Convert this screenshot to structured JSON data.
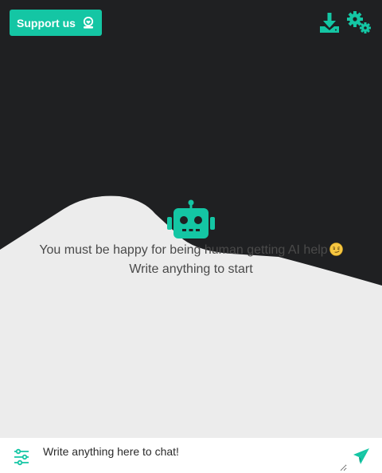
{
  "colors": {
    "accent": "#14c6a4",
    "dark_background": "#1f2022",
    "light_background": "#ececec",
    "text": "#4a4a4a"
  },
  "header": {
    "support_label": "Support us",
    "support_icon": "hand-heart-icon",
    "download_icon": "download-icon",
    "settings_icon": "gears-icon"
  },
  "main": {
    "bot_icon": "robot-icon",
    "welcome_line1": "You must be happy for being human getting AI help",
    "welcome_emoji": "smirk-emoji",
    "welcome_line2": "Write anything to start"
  },
  "chat": {
    "settings_icon": "sliders-icon",
    "input_placeholder": "Write anything here to chat!",
    "input_value": "",
    "send_icon": "send-icon"
  }
}
